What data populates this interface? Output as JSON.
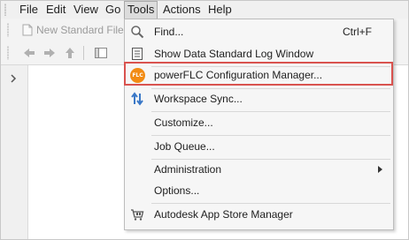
{
  "menubar": {
    "items": [
      {
        "label": "File"
      },
      {
        "label": "Edit"
      },
      {
        "label": "View"
      },
      {
        "label": "Go"
      },
      {
        "label": "Tools"
      },
      {
        "label": "Actions"
      },
      {
        "label": "Help"
      }
    ],
    "active": "Tools"
  },
  "toolbar": {
    "new_file_label": "New Standard File"
  },
  "tools_menu": {
    "items": [
      {
        "label": "Find...",
        "shortcut": "Ctrl+F",
        "icon": "magnifier-icon"
      },
      {
        "label": "Show Data Standard Log Window",
        "icon": "document-icon"
      },
      {
        "label": "powerFLC Configuration Manager...",
        "icon": "flc-badge-icon",
        "badge_text": "FLC"
      },
      {
        "label": "Workspace Sync...",
        "icon": "sync-arrows-icon"
      },
      {
        "label": "Customize..."
      },
      {
        "label": "Job Queue..."
      },
      {
        "label": "Administration",
        "has_submenu": true
      },
      {
        "label": "Options..."
      },
      {
        "label": "Autodesk App Store Manager",
        "icon": "app-store-icon"
      }
    ],
    "highlighted_item": "powerFLC Configuration Manager..."
  },
  "colors": {
    "highlight_border": "#d9534f",
    "flc_badge": "#f28b14",
    "sync_icon": "#3a78c7"
  }
}
